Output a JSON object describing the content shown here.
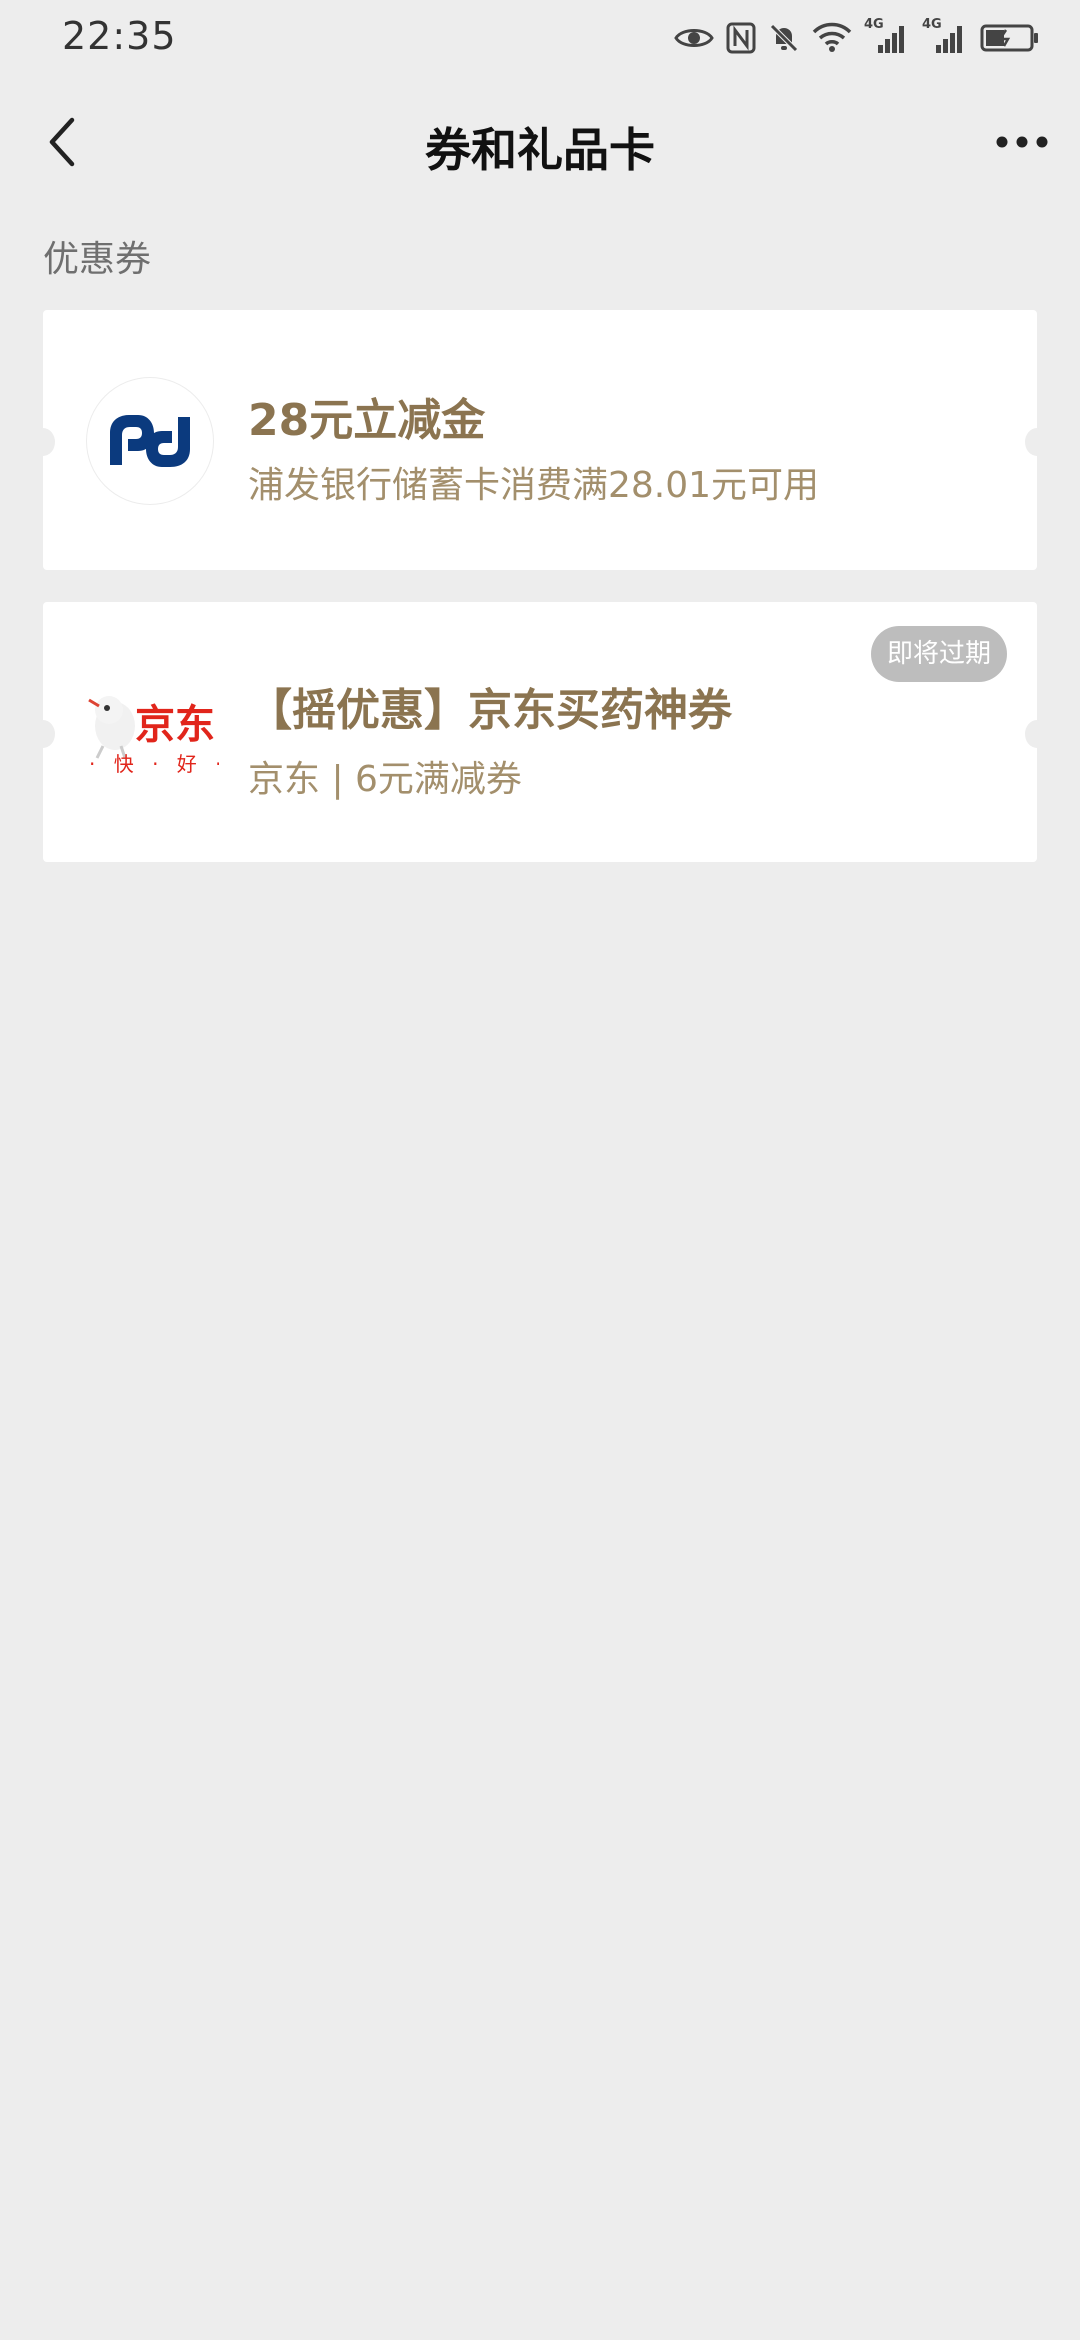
{
  "status_bar": {
    "time": "22:35",
    "icons": [
      "eye-icon",
      "nfc-icon",
      "mute-icon",
      "wifi-icon",
      "signal-4g-icon",
      "signal-4g-icon",
      "battery-icon"
    ],
    "network_label_1": "4G",
    "network_label_2": "4G"
  },
  "nav": {
    "title": "券和礼品卡",
    "back_icon": "chevron-left-icon",
    "more_icon": "more-dots-icon"
  },
  "section": {
    "label": "优惠券"
  },
  "coupons": [
    {
      "title": "28元立减金",
      "description": "浦发银行储蓄卡消费满28.01元可用",
      "logo": "spdb-logo",
      "badge": ""
    },
    {
      "title": "【摇优惠】京东买药神券",
      "description": "京东 | 6元满减券",
      "logo": "jd-logo",
      "logo_text": "京东",
      "logo_subtext": "· 快 · 好 ·",
      "badge": "即将过期"
    }
  ],
  "colors": {
    "background": "#ededed",
    "card": "#ffffff",
    "title_gold": "#8b7450",
    "desc_gold": "#a38f6c",
    "badge_gray": "#bdbdbd",
    "spdb_blue": "#0b3a7e",
    "jd_red": "#e1251b"
  }
}
